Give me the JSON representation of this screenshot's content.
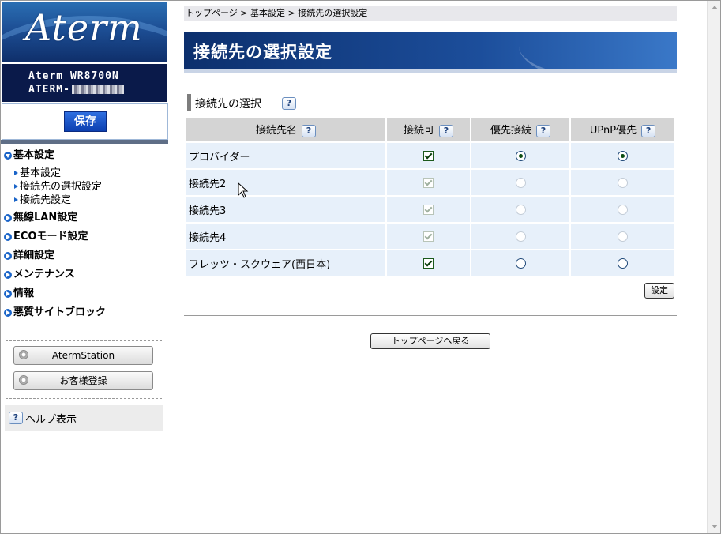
{
  "sidebar": {
    "brand": "Aterm",
    "model_line1": "Aterm WR8700N",
    "model_line2": "ATERM-",
    "save_label": "保存",
    "nav": [
      {
        "label": "基本設定",
        "expanded": true,
        "subs": [
          "基本設定",
          "接続先の選択設定",
          "接続先設定"
        ]
      },
      {
        "label": "無線LAN設定",
        "expanded": false
      },
      {
        "label": "ECOモード設定",
        "expanded": false
      },
      {
        "label": "詳細設定",
        "expanded": false
      },
      {
        "label": "メンテナンス",
        "expanded": false
      },
      {
        "label": "情報",
        "expanded": false
      },
      {
        "label": "悪質サイトブロック",
        "expanded": false
      }
    ],
    "aterm_station": "AtermStation",
    "register": "お客様登録",
    "help": "ヘルプ表示"
  },
  "breadcrumb": "トップページ > 基本設定 > 接続先の選択設定",
  "page_title": "接続先の選択設定",
  "section_title": "接続先の選択",
  "table": {
    "headers": [
      "接続先名",
      "接続可",
      "優先接続",
      "UPnP優先"
    ],
    "rows": [
      {
        "name": "プロバイダー",
        "enabled": true,
        "disabled": false,
        "priority": true,
        "upnp": true
      },
      {
        "name": "接続先2",
        "enabled": true,
        "disabled": true,
        "priority": false,
        "upnp": false
      },
      {
        "name": "接続先3",
        "enabled": true,
        "disabled": true,
        "priority": false,
        "upnp": false
      },
      {
        "name": "接続先4",
        "enabled": true,
        "disabled": true,
        "priority": false,
        "upnp": false
      },
      {
        "name": "フレッツ・スクウェア(西日本)",
        "enabled": true,
        "disabled": false,
        "priority": false,
        "upnp": false
      }
    ]
  },
  "set_label": "設定",
  "back_label": "トップページへ戻る",
  "help_icon": "?",
  "colors": {
    "title_bar": "#1c4e9b",
    "row_bg": "#e7f0fa",
    "header_bg": "#d4d4d4",
    "nav_icon": "#1a64c8"
  }
}
